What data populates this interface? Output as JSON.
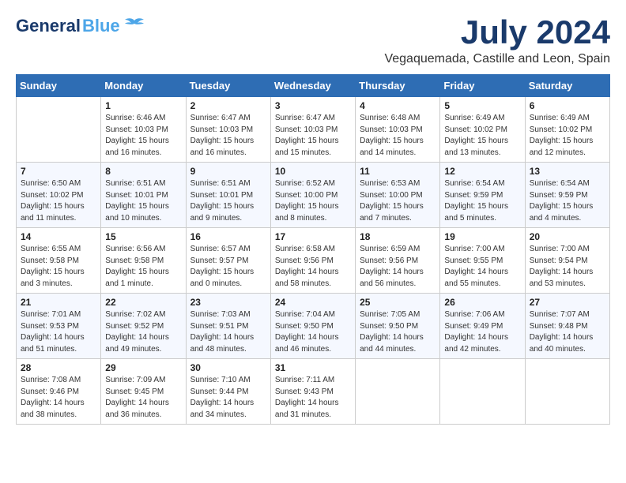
{
  "header": {
    "logo_general": "General",
    "logo_blue": "Blue",
    "month_title": "July 2024",
    "location": "Vegaquemada, Castille and Leon, Spain"
  },
  "calendar": {
    "weekdays": [
      "Sunday",
      "Monday",
      "Tuesday",
      "Wednesday",
      "Thursday",
      "Friday",
      "Saturday"
    ],
    "weeks": [
      [
        {
          "day": "",
          "info": ""
        },
        {
          "day": "1",
          "info": "Sunrise: 6:46 AM\nSunset: 10:03 PM\nDaylight: 15 hours\nand 16 minutes."
        },
        {
          "day": "2",
          "info": "Sunrise: 6:47 AM\nSunset: 10:03 PM\nDaylight: 15 hours\nand 16 minutes."
        },
        {
          "day": "3",
          "info": "Sunrise: 6:47 AM\nSunset: 10:03 PM\nDaylight: 15 hours\nand 15 minutes."
        },
        {
          "day": "4",
          "info": "Sunrise: 6:48 AM\nSunset: 10:03 PM\nDaylight: 15 hours\nand 14 minutes."
        },
        {
          "day": "5",
          "info": "Sunrise: 6:49 AM\nSunset: 10:02 PM\nDaylight: 15 hours\nand 13 minutes."
        },
        {
          "day": "6",
          "info": "Sunrise: 6:49 AM\nSunset: 10:02 PM\nDaylight: 15 hours\nand 12 minutes."
        }
      ],
      [
        {
          "day": "7",
          "info": "Sunrise: 6:50 AM\nSunset: 10:02 PM\nDaylight: 15 hours\nand 11 minutes."
        },
        {
          "day": "8",
          "info": "Sunrise: 6:51 AM\nSunset: 10:01 PM\nDaylight: 15 hours\nand 10 minutes."
        },
        {
          "day": "9",
          "info": "Sunrise: 6:51 AM\nSunset: 10:01 PM\nDaylight: 15 hours\nand 9 minutes."
        },
        {
          "day": "10",
          "info": "Sunrise: 6:52 AM\nSunset: 10:00 PM\nDaylight: 15 hours\nand 8 minutes."
        },
        {
          "day": "11",
          "info": "Sunrise: 6:53 AM\nSunset: 10:00 PM\nDaylight: 15 hours\nand 7 minutes."
        },
        {
          "day": "12",
          "info": "Sunrise: 6:54 AM\nSunset: 9:59 PM\nDaylight: 15 hours\nand 5 minutes."
        },
        {
          "day": "13",
          "info": "Sunrise: 6:54 AM\nSunset: 9:59 PM\nDaylight: 15 hours\nand 4 minutes."
        }
      ],
      [
        {
          "day": "14",
          "info": "Sunrise: 6:55 AM\nSunset: 9:58 PM\nDaylight: 15 hours\nand 3 minutes."
        },
        {
          "day": "15",
          "info": "Sunrise: 6:56 AM\nSunset: 9:58 PM\nDaylight: 15 hours\nand 1 minute."
        },
        {
          "day": "16",
          "info": "Sunrise: 6:57 AM\nSunset: 9:57 PM\nDaylight: 15 hours\nand 0 minutes."
        },
        {
          "day": "17",
          "info": "Sunrise: 6:58 AM\nSunset: 9:56 PM\nDaylight: 14 hours\nand 58 minutes."
        },
        {
          "day": "18",
          "info": "Sunrise: 6:59 AM\nSunset: 9:56 PM\nDaylight: 14 hours\nand 56 minutes."
        },
        {
          "day": "19",
          "info": "Sunrise: 7:00 AM\nSunset: 9:55 PM\nDaylight: 14 hours\nand 55 minutes."
        },
        {
          "day": "20",
          "info": "Sunrise: 7:00 AM\nSunset: 9:54 PM\nDaylight: 14 hours\nand 53 minutes."
        }
      ],
      [
        {
          "day": "21",
          "info": "Sunrise: 7:01 AM\nSunset: 9:53 PM\nDaylight: 14 hours\nand 51 minutes."
        },
        {
          "day": "22",
          "info": "Sunrise: 7:02 AM\nSunset: 9:52 PM\nDaylight: 14 hours\nand 49 minutes."
        },
        {
          "day": "23",
          "info": "Sunrise: 7:03 AM\nSunset: 9:51 PM\nDaylight: 14 hours\nand 48 minutes."
        },
        {
          "day": "24",
          "info": "Sunrise: 7:04 AM\nSunset: 9:50 PM\nDaylight: 14 hours\nand 46 minutes."
        },
        {
          "day": "25",
          "info": "Sunrise: 7:05 AM\nSunset: 9:50 PM\nDaylight: 14 hours\nand 44 minutes."
        },
        {
          "day": "26",
          "info": "Sunrise: 7:06 AM\nSunset: 9:49 PM\nDaylight: 14 hours\nand 42 minutes."
        },
        {
          "day": "27",
          "info": "Sunrise: 7:07 AM\nSunset: 9:48 PM\nDaylight: 14 hours\nand 40 minutes."
        }
      ],
      [
        {
          "day": "28",
          "info": "Sunrise: 7:08 AM\nSunset: 9:46 PM\nDaylight: 14 hours\nand 38 minutes."
        },
        {
          "day": "29",
          "info": "Sunrise: 7:09 AM\nSunset: 9:45 PM\nDaylight: 14 hours\nand 36 minutes."
        },
        {
          "day": "30",
          "info": "Sunrise: 7:10 AM\nSunset: 9:44 PM\nDaylight: 14 hours\nand 34 minutes."
        },
        {
          "day": "31",
          "info": "Sunrise: 7:11 AM\nSunset: 9:43 PM\nDaylight: 14 hours\nand 31 minutes."
        },
        {
          "day": "",
          "info": ""
        },
        {
          "day": "",
          "info": ""
        },
        {
          "day": "",
          "info": ""
        }
      ]
    ]
  }
}
